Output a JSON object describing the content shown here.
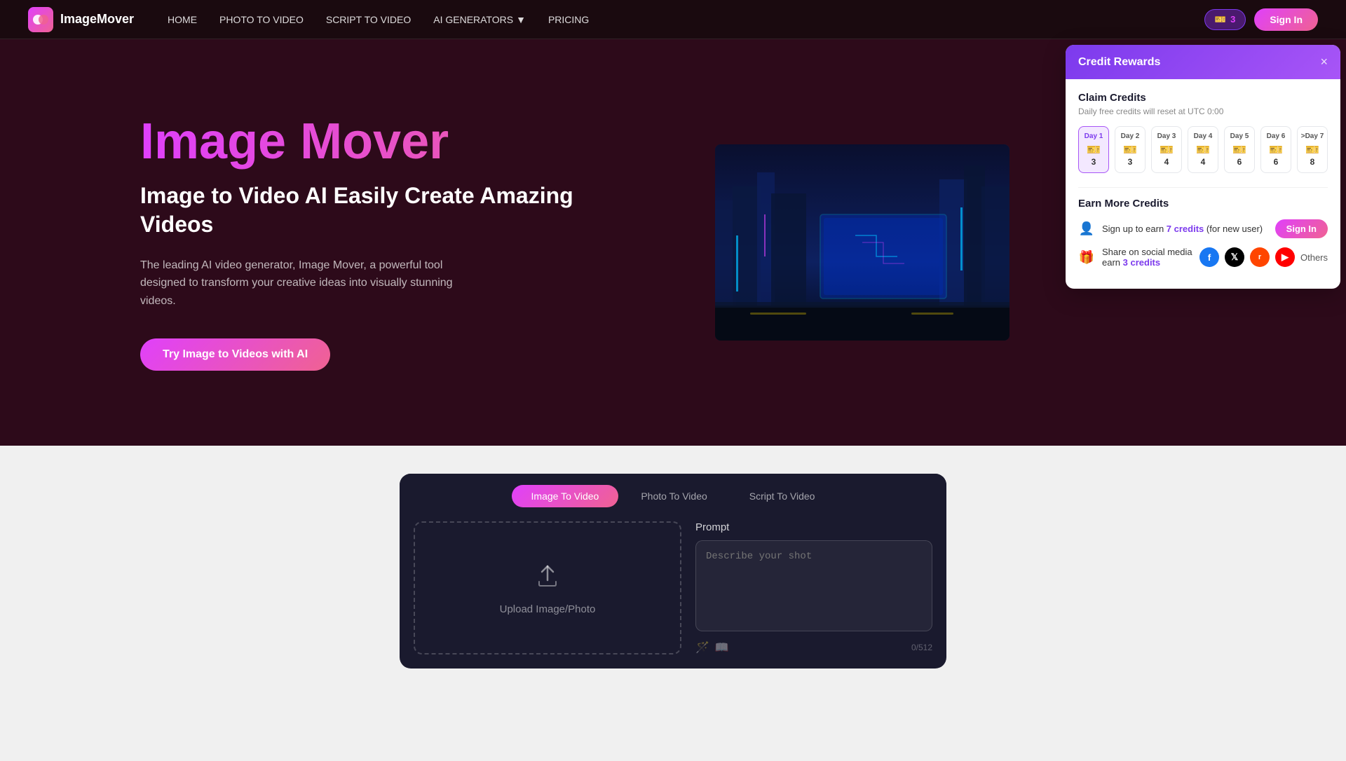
{
  "nav": {
    "logo_text": "ImageMover",
    "links": [
      {
        "label": "HOME",
        "id": "home"
      },
      {
        "label": "PHOTO TO VIDEO",
        "id": "photo-to-video"
      },
      {
        "label": "SCRIPT TO VIDEO",
        "id": "script-to-video"
      },
      {
        "label": "AI GENERATORS",
        "id": "ai-generators",
        "has_dropdown": true
      },
      {
        "label": "PRICING",
        "id": "pricing"
      }
    ],
    "credits_count": "3",
    "sign_in_label": "Sign In"
  },
  "hero": {
    "title": "Image Mover",
    "subtitle": "Image to Video AI Easily Create Amazing Videos",
    "description": "The leading AI video generator, Image Mover, a powerful tool designed to transform your creative ideas into visually stunning videos.",
    "cta_label": "Try Image to Videos with AI"
  },
  "bottom_tabs": {
    "tabs": [
      {
        "label": "Image To Video",
        "id": "image-to-video",
        "active": true
      },
      {
        "label": "Photo To Video",
        "id": "photo-to-video",
        "active": false
      },
      {
        "label": "Script To Video",
        "id": "script-to-video",
        "active": false
      }
    ],
    "upload_label": "Upload Image/Photo",
    "prompt_label": "Prompt",
    "prompt_placeholder": "Describe your shot",
    "prompt_count": "0/512"
  },
  "credit_popup": {
    "title": "Credit Rewards",
    "close_label": "×",
    "claim_title": "Claim Credits",
    "claim_subtitle": "Daily free credits will reset at UTC 0:00",
    "days": [
      {
        "label": "Day 1",
        "credits": 3,
        "active": true
      },
      {
        "label": "Day 2",
        "credits": 3,
        "active": false
      },
      {
        "label": "Day 3",
        "credits": 4,
        "active": false
      },
      {
        "label": "Day 4",
        "credits": 4,
        "active": false
      },
      {
        "label": "Day 5",
        "credits": 6,
        "active": false
      },
      {
        "label": "Day 6",
        "credits": 6,
        "active": false
      },
      {
        "label": ">Day 7",
        "credits": 8,
        "active": false
      }
    ],
    "earn_title": "Earn More Credits",
    "earn_signup_text": "Sign up to earn ",
    "earn_signup_credits": "7 credits",
    "earn_signup_note": "(for new user)",
    "earn_signin_label": "Sign In",
    "earn_share_text": "Share on social media earn ",
    "earn_share_credits": "3 credits",
    "social_platforms": [
      {
        "label": "f",
        "class": "fb",
        "name": "facebook"
      },
      {
        "label": "𝕏",
        "class": "tw",
        "name": "twitter"
      },
      {
        "label": "R",
        "class": "rd",
        "name": "reddit"
      },
      {
        "label": "▶",
        "class": "yt",
        "name": "youtube"
      }
    ],
    "others_label": "Others"
  }
}
